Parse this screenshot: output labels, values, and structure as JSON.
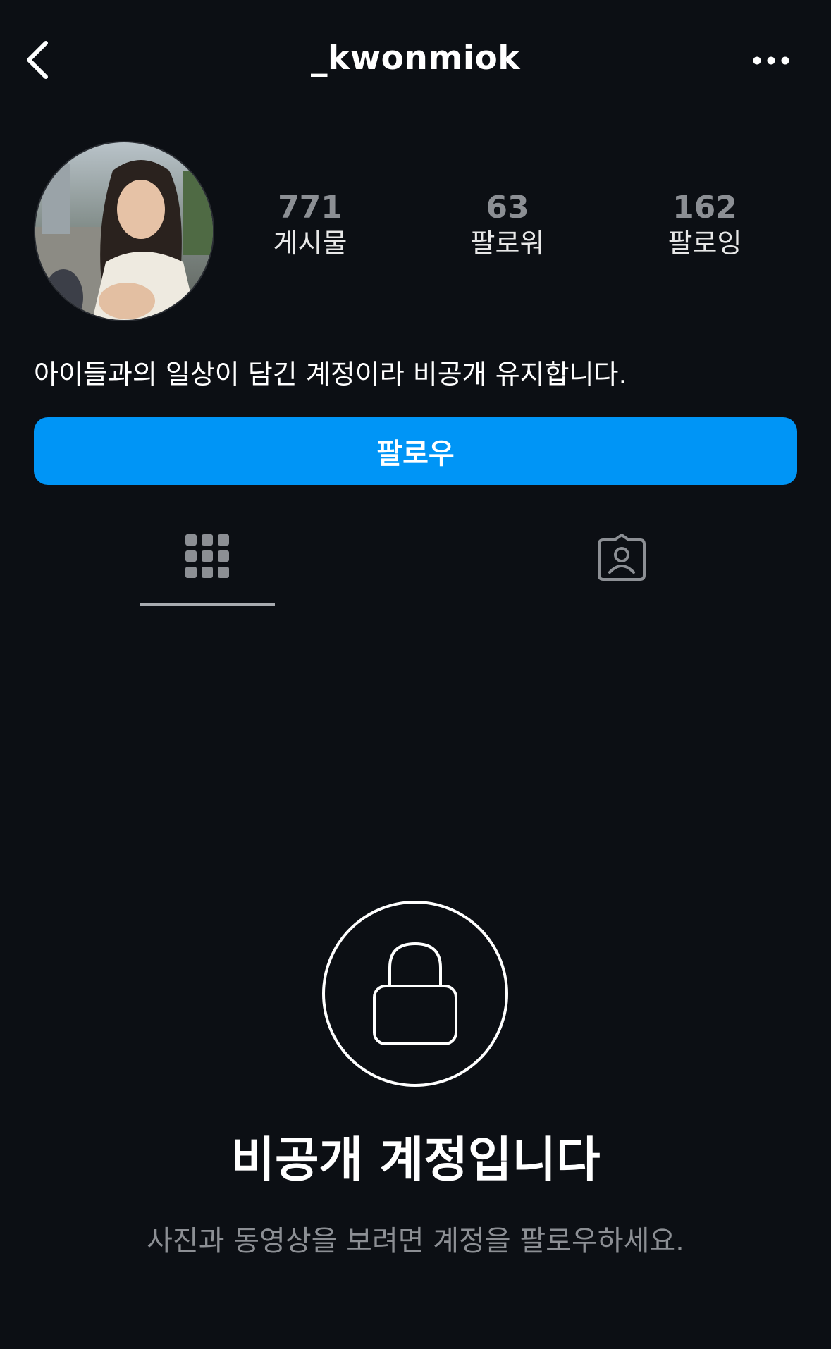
{
  "header": {
    "username": "_kwonmiok",
    "back_icon": "chevron-left-icon",
    "more_icon": "more-horizontal-icon"
  },
  "profile": {
    "avatar": "profile-photo",
    "stats": [
      {
        "count": "771",
        "label": "게시물"
      },
      {
        "count": "63",
        "label": "팔로워"
      },
      {
        "count": "162",
        "label": "팔로잉"
      }
    ],
    "bio": "아이들과의 일상이 담긴 계정이라 비공개 유지합니다."
  },
  "follow_button": {
    "label": "팔로우",
    "color": "#0095f6"
  },
  "tabs": [
    {
      "icon": "grid-icon",
      "active": true
    },
    {
      "icon": "tagged-user-icon",
      "active": false
    }
  ],
  "private_notice": {
    "icon": "lock-icon",
    "title": "비공개 계정입니다",
    "subtitle": "사진과 동영상을 보려면 계정을 팔로우하세요."
  },
  "colors": {
    "background": "#0c0f14",
    "text": "#ffffff",
    "muted": "#8c8f94",
    "accent": "#0095f6"
  }
}
